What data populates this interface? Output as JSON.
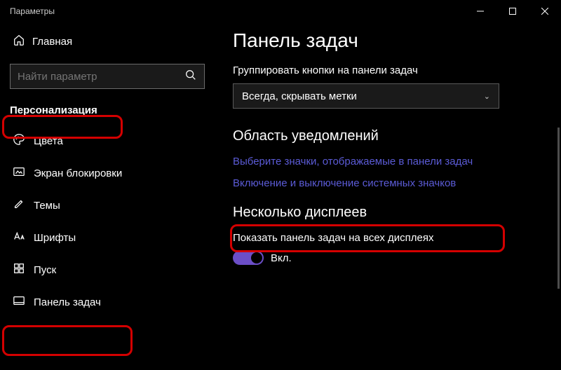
{
  "window": {
    "title": "Параметры"
  },
  "sidebar": {
    "home": "Главная",
    "search_placeholder": "Найти параметр",
    "category": "Персонализация",
    "items": [
      {
        "label": "Цвета"
      },
      {
        "label": "Экран блокировки"
      },
      {
        "label": "Темы"
      },
      {
        "label": "Шрифты"
      },
      {
        "label": "Пуск"
      },
      {
        "label": "Панель задач"
      }
    ]
  },
  "content": {
    "title": "Панель задач",
    "group_label": "Группировать кнопки на панели задач",
    "group_value": "Всегда, скрывать метки",
    "section_notify": "Область уведомлений",
    "link_select_icons": "Выберите значки, отображаемые в панели задач",
    "link_system_icons": "Включение и выключение системных значков",
    "section_displays": "Несколько дисплеев",
    "show_taskbar_label": "Показать панель задач на всех дисплеях",
    "toggle_on": "Вкл."
  }
}
